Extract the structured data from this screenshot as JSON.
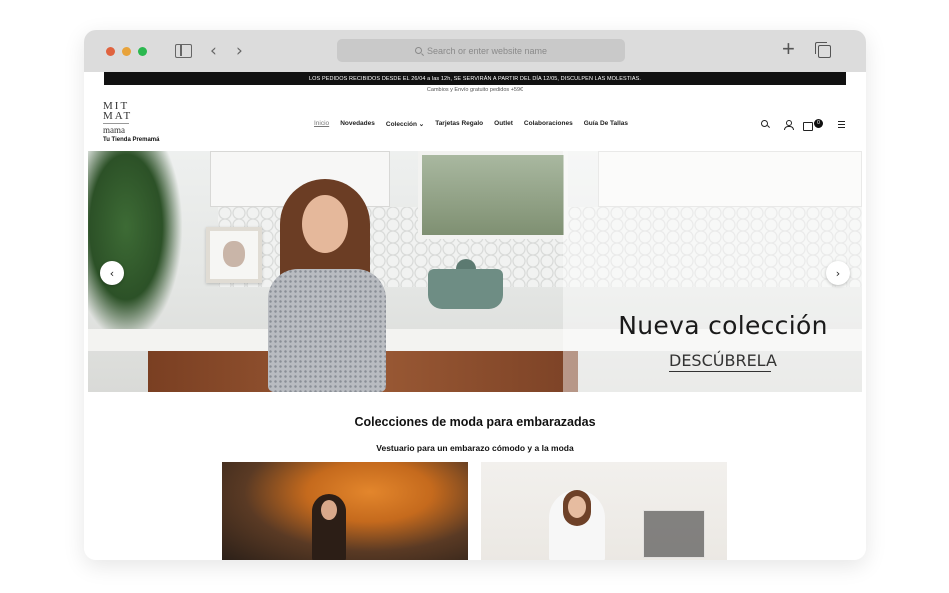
{
  "browser": {
    "address_placeholder": "Search or enter website name",
    "back_symbol": "‹",
    "forward_symbol": "›",
    "new_tab_symbol": "+"
  },
  "announcement": {
    "text": "LOS PEDIDOS RECIBIDOS DESDE EL 26/04 a las 12h, SE SERVIRÁN A PARTIR DEL DÍA 12/05, DISCULPEN LAS MOLESTIAS."
  },
  "promo": {
    "text": "Cambios y Envío gratuito pedidos +59€"
  },
  "logo": {
    "line1": "MIT",
    "line2": "MAT",
    "line3": "mama",
    "tagline": "Tu Tienda Premamá"
  },
  "nav": {
    "items": [
      {
        "label": "Inicio"
      },
      {
        "label": "Novedades"
      },
      {
        "label": "Colección ⌄"
      },
      {
        "label": "Tarjetas Regalo"
      },
      {
        "label": "Outlet"
      },
      {
        "label": "Colaboraciones"
      },
      {
        "label": "Guía De Tallas"
      }
    ]
  },
  "header_icons": {
    "search": "search-icon",
    "account": "user-icon",
    "cart": "cart-icon",
    "cart_count": "0",
    "menu": "menu-icon"
  },
  "hero": {
    "title": "Nueva colección",
    "cta": "DESCÚBRELA",
    "prev_symbol": "‹",
    "next_symbol": "›"
  },
  "collections": {
    "title": "Colecciones de moda para embarazadas",
    "subtitle": "Vestuario para un embarazo cómodo y a la moda"
  },
  "colors": {
    "announcement_bg": "#111111",
    "chrome_bg": "#dcdcdc",
    "traffic_red": "#e0633f",
    "traffic_yellow": "#e8a33b",
    "traffic_green": "#2bb84f"
  }
}
